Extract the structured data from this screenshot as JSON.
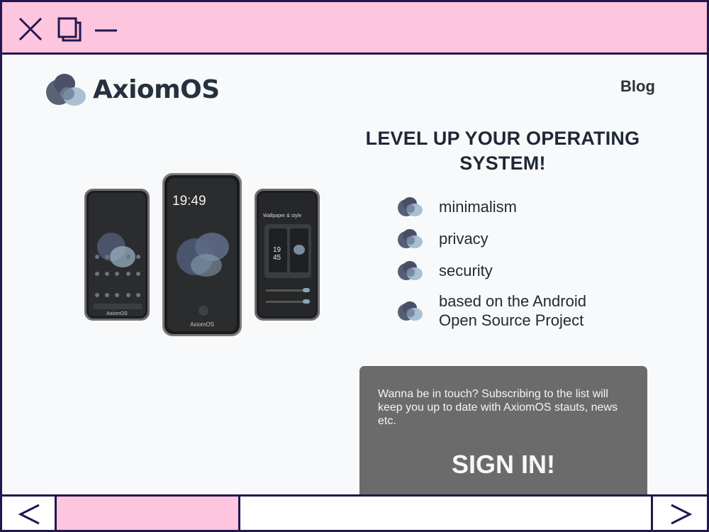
{
  "window": {
    "controls": [
      "close-icon",
      "maximize-icon",
      "minimize-icon"
    ],
    "frame_color": "#23174f",
    "chrome_color": "#fdc5de"
  },
  "header": {
    "brand": "AxiomOS",
    "nav_blog": "Blog"
  },
  "hero": {
    "headline_line1": "LEVEL UP YOUR OPERATING",
    "headline_line2": "SYSTEM!",
    "phones": {
      "left_caption": "AxiomOS",
      "center_time_hour": "19:49",
      "center_caption": "AxiomOS",
      "right_title": "Wallpaper & style",
      "right_clock_h": "19",
      "right_clock_m": "45"
    }
  },
  "features": [
    {
      "label_line1": "minimalism",
      "label_line2": ""
    },
    {
      "label_line1": "privacy",
      "label_line2": ""
    },
    {
      "label_line1": "security",
      "label_line2": ""
    },
    {
      "label_line1": "based on the Android",
      "label_line2": "Open Source Project"
    }
  ],
  "subscribe": {
    "text": "Wanna be in touch? Subscribing to the list will keep you up to date with AxiomOS stauts, news etc.",
    "button": "SIGN IN!",
    "background": "#6b6b6b"
  },
  "bottom_bar": {
    "back_icon": "chevron-left-icon",
    "forward_icon": "chevron-right-icon"
  }
}
